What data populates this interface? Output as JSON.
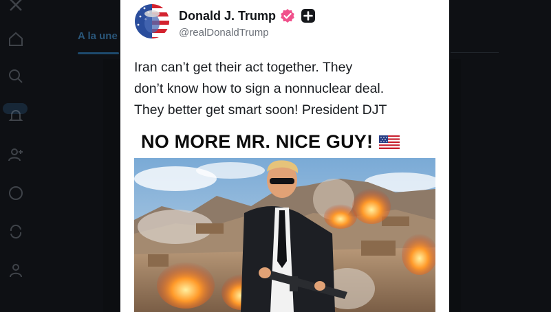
{
  "background": {
    "tab_label": "A la une",
    "right_tab_label": "",
    "rail_icons": [
      "close-icon",
      "home-icon",
      "search-icon",
      "notifications-icon",
      "add-user-icon",
      "messages-icon",
      "repost-icon",
      "profile-icon"
    ]
  },
  "post": {
    "author": {
      "display_name": "Donald J. Trump",
      "handle": "@realDonaldTrump",
      "verified": true
    },
    "text_lines": [
      "Iran can’t get their act together. They",
      "don’t know how to sign a nonnuclear deal.",
      "They better get smart soon! President DJT"
    ],
    "image": {
      "headline": "NO MORE MR. NICE GUY!",
      "flag": "us-flag-icon"
    }
  },
  "colors": {
    "verified_badge": "#f0508b",
    "card_background": "#ffffff",
    "app_background": "#0e1014"
  }
}
